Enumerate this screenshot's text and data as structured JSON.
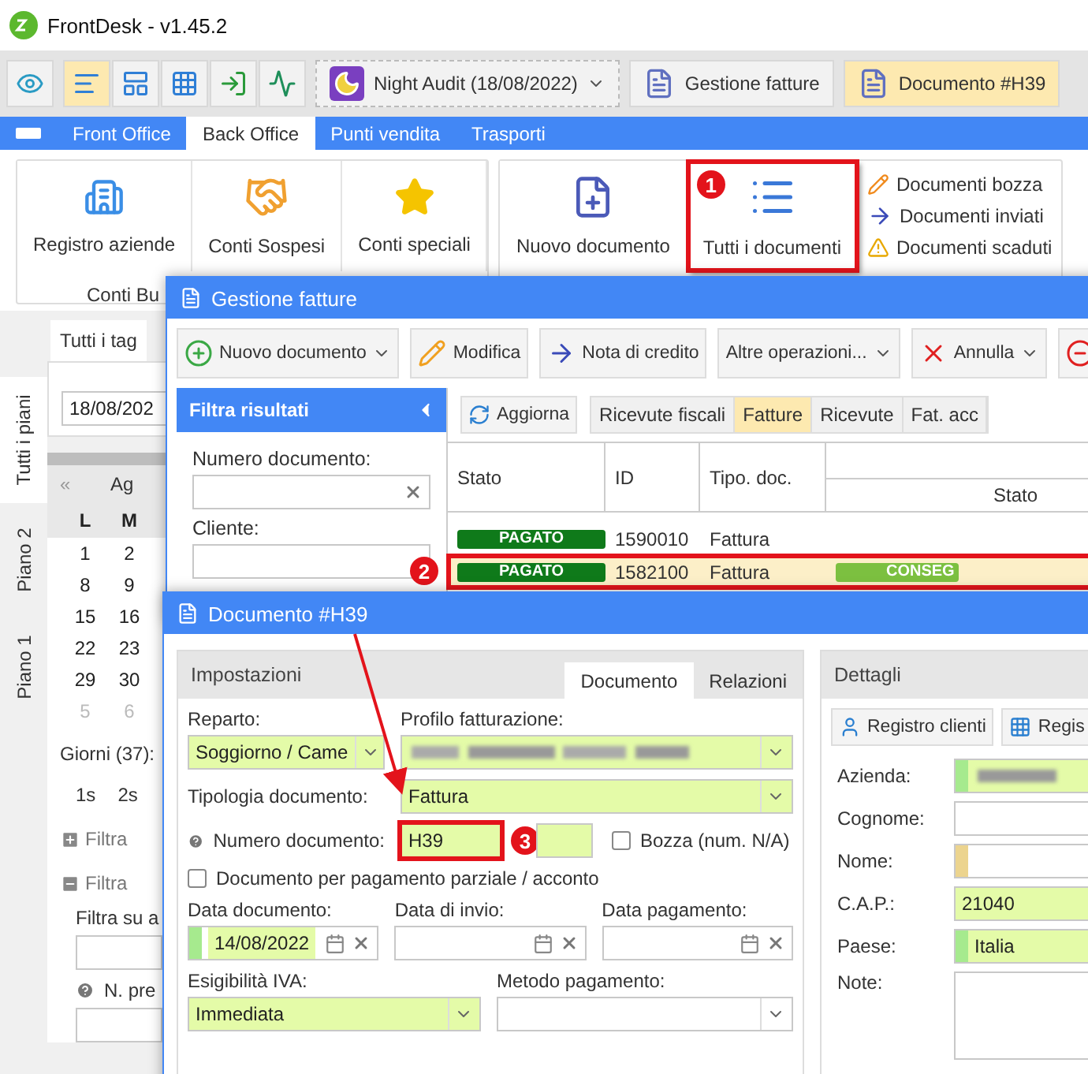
{
  "window": {
    "title": "FrontDesk - v1.45.2"
  },
  "toolbar": {
    "buttons": [
      {
        "kind": "eye",
        "selected": false
      },
      {
        "kind": "lines",
        "selected": true
      },
      {
        "kind": "layout",
        "selected": false
      },
      {
        "kind": "grid",
        "selected": false
      },
      {
        "kind": "exit",
        "selected": false
      },
      {
        "kind": "monitor",
        "selected": false
      }
    ],
    "night_audit": "Night Audit (18/08/2022)",
    "open_windows": [
      {
        "label": "Gestione fatture",
        "selected": false
      },
      {
        "label": "Documento #H39",
        "selected": true
      }
    ]
  },
  "nav_tabs": [
    {
      "label": "Front Office",
      "selected": false
    },
    {
      "label": "Back Office",
      "selected": true
    },
    {
      "label": "Punti vendita",
      "selected": false
    },
    {
      "label": "Trasporti",
      "selected": false
    }
  ],
  "ribbon": {
    "groups": [
      {
        "caption": "Conti Bu",
        "items": [
          {
            "kind": "building",
            "label": "Registro aziende",
            "highlighted": false
          },
          {
            "kind": "handshake",
            "label": "Conti Sospesi",
            "highlighted": false
          },
          {
            "kind": "star",
            "label": "Conti speciali",
            "highlighted": false
          }
        ]
      },
      {
        "items": [
          {
            "kind": "newdoc",
            "label": "Nuovo documento",
            "highlighted": false
          },
          {
            "kind": "list",
            "label": "Tutti i documenti",
            "highlighted": true,
            "badge": "1"
          }
        ],
        "side_items": [
          {
            "kind": "pencil",
            "label": "Documenti bozza"
          },
          {
            "kind": "arrow",
            "label": "Documenti inviati"
          },
          {
            "kind": "warning",
            "label": "Documenti scaduti"
          }
        ]
      }
    ]
  },
  "left_panel": {
    "vertical_tabs": [
      {
        "label": "Tutti i piani",
        "selected": true
      },
      {
        "label": "Piano 2",
        "selected": false
      },
      {
        "label": "Piano 1",
        "selected": false
      }
    ],
    "tag_tab": "Tutti i tag",
    "date": "18/08/202",
    "calendar": {
      "nav": "«",
      "month": "Ag",
      "weekdays": [
        "L",
        "M"
      ],
      "weeks": [
        {
          "days": [
            "1",
            "2"
          ],
          "muted": false
        },
        {
          "days": [
            "8",
            "9"
          ],
          "muted": false
        },
        {
          "days": [
            "15",
            "16"
          ],
          "muted": false
        },
        {
          "days": [
            "22",
            "23"
          ],
          "muted": false
        },
        {
          "days": [
            "29",
            "30"
          ],
          "muted": false
        },
        {
          "days": [
            "5",
            "6"
          ],
          "muted": true
        }
      ]
    },
    "days_label": "Giorni (37):",
    "day_buttons": [
      "1s",
      "2s"
    ],
    "sections": [
      {
        "label": "Filtra",
        "expanded": false
      },
      {
        "label": "Filtra",
        "expanded": true
      }
    ],
    "filter_label": "Filtra su a",
    "help_label": "N. pre"
  },
  "invoices_window": {
    "title": "Gestione fatture",
    "buttons": [
      {
        "kind": "add",
        "label": "Nuovo documento",
        "dropdown": true
      },
      {
        "kind": "edit",
        "label": "Modifica",
        "dropdown": false
      },
      {
        "kind": "arrow",
        "label": "Nota di credito",
        "dropdown": false
      },
      {
        "kind": "plain",
        "label": "Altre operazioni...",
        "dropdown": true
      },
      {
        "kind": "cancel",
        "label": "Annulla",
        "dropdown": true
      },
      {
        "kind": "remove",
        "dropdown": false
      }
    ],
    "filter": {
      "title": "Filtra risultati",
      "fields": [
        {
          "label": "Numero documento:"
        },
        {
          "label": "Cliente:"
        }
      ]
    },
    "refresh": "Aggiorna",
    "doc_tabs": [
      {
        "label": "Ricevute fiscali",
        "selected": false
      },
      {
        "label": "Fatture",
        "selected": true
      },
      {
        "label": "Ricevute",
        "selected": false
      },
      {
        "label": "Fat. acc",
        "selected": false
      }
    ],
    "columns": [
      "Stato",
      "ID",
      "Tipo. doc."
    ],
    "sub_column": "Stato",
    "rows": [
      {
        "status": "PAGATO",
        "id": "1590010",
        "type": "Fattura",
        "selected": false
      },
      {
        "status": "PAGATO",
        "id": "1582100",
        "type": "Fattura",
        "delivery": "CONSEG",
        "selected": true,
        "badge": "2"
      }
    ]
  },
  "document_window": {
    "title": "Documento #H39",
    "settings": {
      "title": "Impostazioni",
      "tabs": [
        {
          "label": "Documento",
          "selected": true
        },
        {
          "label": "Relazioni",
          "selected": false
        }
      ],
      "department": {
        "label": "Reparto:",
        "value": "Soggiorno / Came"
      },
      "profile": {
        "label": "Profilo fatturazione:"
      },
      "doc_type": {
        "label": "Tipologia documento:",
        "value": "Fattura"
      },
      "number": {
        "label": "Numero documento:",
        "value": "H39",
        "highlighted": true,
        "badge": "3"
      },
      "draft": {
        "label": "Bozza (num. N/A)",
        "checked": false
      },
      "partial": {
        "label": "Documento per pagamento parziale / acconto",
        "checked": false
      },
      "dates": [
        {
          "label": "Data documento:",
          "value": "14/08/2022"
        },
        {
          "label": "Data di invio:"
        },
        {
          "label": "Data pagamento:"
        }
      ],
      "vat": {
        "label": "Esigibilità IVA:",
        "value": "Immediata"
      },
      "payment": {
        "label": "Metodo pagamento:"
      }
    },
    "details": {
      "title": "Dettagli",
      "buttons": [
        {
          "kind": "person",
          "label": "Registro clienti"
        },
        {
          "kind": "grid",
          "label": "Regis"
        }
      ],
      "fields": [
        {
          "label": "Azienda:",
          "kind": "redacted",
          "color": "#a6ea8e"
        },
        {
          "label": "Cognome:",
          "kind": "text"
        },
        {
          "label": "Nome:",
          "kind": "text",
          "color": "#ecd48e"
        },
        {
          "label": "C.A.P.:",
          "kind": "text",
          "value": "21040"
        },
        {
          "label": "Paese:",
          "kind": "text",
          "value": "Italia",
          "color": "#a6ea8e"
        },
        {
          "label": "Note:",
          "kind": "note"
        }
      ]
    }
  }
}
